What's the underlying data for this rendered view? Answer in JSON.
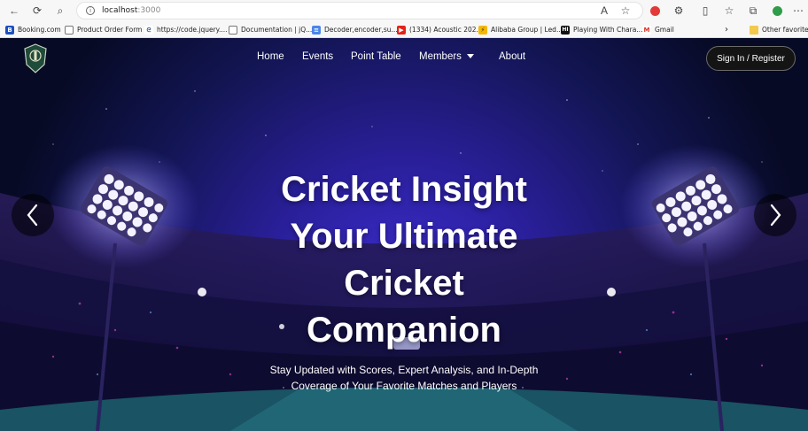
{
  "browser": {
    "url_host": "localhost",
    "url_port": ":3000",
    "bookmarks": [
      {
        "label": "Booking.com",
        "icon": "booking-icon",
        "color": "#1d4fbf",
        "glyph": "B."
      },
      {
        "label": "Product Order Form",
        "icon": "page-icon",
        "color": "#ffffff",
        "glyph": ""
      },
      {
        "label": "https://code.jquery....",
        "icon": "jquery-icon",
        "color": "#ffffff",
        "glyph": ""
      },
      {
        "label": "Documentation | jQ...",
        "icon": "page-icon",
        "color": "#ffffff",
        "glyph": ""
      },
      {
        "label": "Decoder,encoder,su...",
        "icon": "docs-icon",
        "color": "#4a86e8",
        "glyph": ""
      },
      {
        "label": "(1334) Acoustic 202...",
        "icon": "youtube-icon",
        "color": "#e62117",
        "glyph": "▶"
      },
      {
        "label": "Alibaba Group | Led...",
        "icon": "alibaba-icon",
        "color": "#f5b800",
        "glyph": ""
      },
      {
        "label": "Playing With Chara...",
        "icon": "hd-icon",
        "color": "#111111",
        "glyph": "HI"
      },
      {
        "label": "Gmail",
        "icon": "gmail-icon",
        "color": "#ffffff",
        "glyph": "M"
      }
    ],
    "other_favorites": "Other favorites"
  },
  "nav": {
    "links": [
      "Home",
      "Events",
      "Point Table",
      "Members",
      "About"
    ],
    "signin_label": "Sign In / Register"
  },
  "hero": {
    "title_lines": [
      "Cricket Insight",
      "Your Ultimate",
      "Cricket",
      "Companion"
    ],
    "subtitle_lines": [
      "Stay Updated with Scores, Expert Analysis, and In-Depth",
      "Coverage of Your Favorite Matches and Players"
    ]
  },
  "carousel": {
    "prev_glyph": "‹",
    "next_glyph": "›"
  },
  "colors": {
    "sky": "#0a0d2e",
    "stadium_glow": "#4a3cff",
    "floodlight": "#ffffff",
    "nav_button_bg": "#141414"
  }
}
